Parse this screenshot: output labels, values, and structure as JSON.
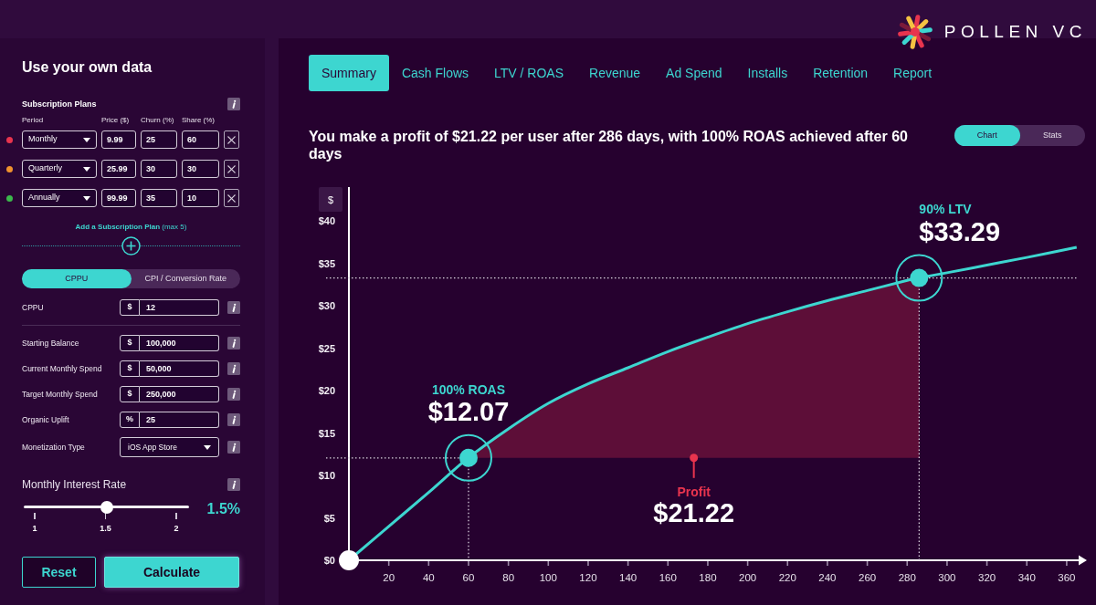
{
  "header": {
    "logo": "POLLEN VC"
  },
  "sidebar": {
    "title": "Use your own data",
    "plans": {
      "title": "Subscription Plans",
      "columns": [
        "Period",
        "Price ($)",
        "Churn (%)",
        "Share (%)"
      ],
      "rows": [
        {
          "color": "#e8344e",
          "period": "Monthly",
          "price": "9.99",
          "churn": "25",
          "share": "60"
        },
        {
          "color": "#f0922e",
          "period": "Quarterly",
          "price": "25.99",
          "churn": "30",
          "share": "30"
        },
        {
          "color": "#3cb84c",
          "period": "Annually",
          "price": "99.99",
          "churn": "35",
          "share": "10"
        }
      ],
      "add_link": "**Add a Subscription Plan** (max 5)"
    },
    "cost_toggle": [
      {
        "label": "CPPU",
        "selected": true
      },
      {
        "label": "CPI / Conversion Rate",
        "selected": false
      }
    ],
    "cost_field": {
      "kind": "input",
      "label": "CPPU",
      "unit": "$",
      "value": "12"
    },
    "fields": [
      {
        "kind": "input",
        "label": "Starting Balance",
        "unit": "$",
        "value": "100,000"
      },
      {
        "kind": "input",
        "label": "Current Monthly Spend",
        "unit": "$",
        "value": "50,000"
      },
      {
        "kind": "input",
        "label": "Target Monthly Spend",
        "unit": "$",
        "value": "250,000"
      },
      {
        "kind": "input",
        "label": "Organic Uplift",
        "unit": "%",
        "value": "25"
      },
      {
        "kind": "select",
        "label": "Monetization Type",
        "value": "iOS App Store"
      }
    ],
    "interest_rate": {
      "label": "Monthly Interest Rate",
      "level": 0.5,
      "ticks": [
        "1",
        "1.5",
        "2"
      ],
      "reading": "1.5%"
    },
    "buttons": [
      {
        "kind": "reset",
        "label": "Reset"
      },
      {
        "kind": "submit",
        "label": "Calculate"
      }
    ]
  },
  "tabs": [
    {
      "label": "Summary",
      "selected": true
    },
    {
      "label": "Cash Flows",
      "selected": false
    },
    {
      "label": "LTV / ROAS",
      "selected": false
    },
    {
      "label": "Revenue",
      "selected": false
    },
    {
      "label": "Ad Spend",
      "selected": false
    },
    {
      "label": "Installs",
      "selected": false
    },
    {
      "label": "Retention",
      "selected": false
    },
    {
      "label": "Report",
      "selected": false
    }
  ],
  "headline": "You make a profit of $21.22 per user after 286 days, with 100% ROAS achieved after 60 days",
  "view_toggle": [
    {
      "label": "Chart",
      "selected": true
    },
    {
      "label": "Stats",
      "selected": false
    }
  ],
  "chart": {
    "chart_data": [
      {
        "type": "line",
        "ylabel": "$",
        "x": [
          0,
          20,
          40,
          60,
          80,
          100,
          120,
          140,
          160,
          180,
          200,
          220,
          240,
          260,
          280,
          286,
          300,
          320,
          340,
          365
        ],
        "values": [
          0,
          4,
          8,
          12.1,
          15.5,
          18.5,
          20.8,
          22.7,
          24.6,
          26.3,
          27.9,
          29.3,
          30.6,
          31.8,
          33,
          33.3,
          33.9,
          34.8,
          35.7,
          36.9
        ],
        "color": "#3dd6d0",
        "xlim": [
          0,
          366
        ],
        "ylim": [
          0,
          44
        ],
        "xticks": [
          20,
          40,
          60,
          80,
          100,
          120,
          140,
          160,
          180,
          200,
          220,
          240,
          260,
          280,
          300,
          320,
          340,
          360
        ],
        "yticks": [
          {
            "value": 0,
            "label": "$0"
          },
          {
            "value": 5,
            "label": "$5"
          },
          {
            "value": 10,
            "label": "$10"
          },
          {
            "value": 15,
            "label": "$15"
          },
          {
            "value": 20,
            "label": "$20"
          },
          {
            "value": 25,
            "label": "$25"
          },
          {
            "value": 30,
            "label": "$30"
          },
          {
            "value": 35,
            "label": "$35"
          },
          {
            "value": 40,
            "label": "$40"
          }
        ],
        "ref_lines": [
          {
            "axis": "x",
            "value": 60,
            "line_style": "dotted"
          },
          {
            "axis": "y",
            "value": 12.07,
            "line_style": "dotted"
          },
          {
            "axis": "x",
            "value": 286,
            "line_style": "dotted"
          },
          {
            "axis": "y",
            "value": 33.29,
            "line_style": "dotted"
          }
        ]
      }
    ],
    "callouts": [
      {
        "kind": "roas",
        "label": "100% ROAS",
        "amount": "$12.07"
      },
      {
        "kind": "ltv",
        "label": "90% LTV",
        "amount": "$33.29"
      },
      {
        "kind": "profit",
        "label": "Profit",
        "amount": "$21.22"
      }
    ]
  }
}
